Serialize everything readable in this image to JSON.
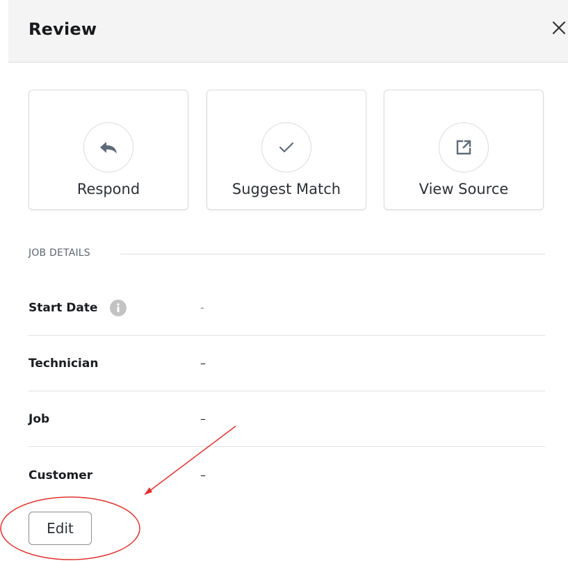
{
  "header": {
    "title": "Review",
    "close_icon": "close-icon"
  },
  "actions": [
    {
      "label": "Respond",
      "icon": "reply-icon"
    },
    {
      "label": "Suggest Match",
      "icon": "check-icon"
    },
    {
      "label": "View Source",
      "icon": "external-link-icon"
    }
  ],
  "job_details": {
    "section_title": "JOB DETAILS",
    "rows": [
      {
        "label": "Start Date",
        "value": "-",
        "icon": "info-icon"
      },
      {
        "label": "Technician",
        "value": "–"
      },
      {
        "label": "Job",
        "value": "–"
      },
      {
        "label": "Customer",
        "value": "–"
      }
    ]
  },
  "edit_button": {
    "label": "Edit"
  },
  "colors": {
    "icon": "#5f6b78",
    "annotation": "#e0302c",
    "header_bg": "#f4f4f4"
  }
}
